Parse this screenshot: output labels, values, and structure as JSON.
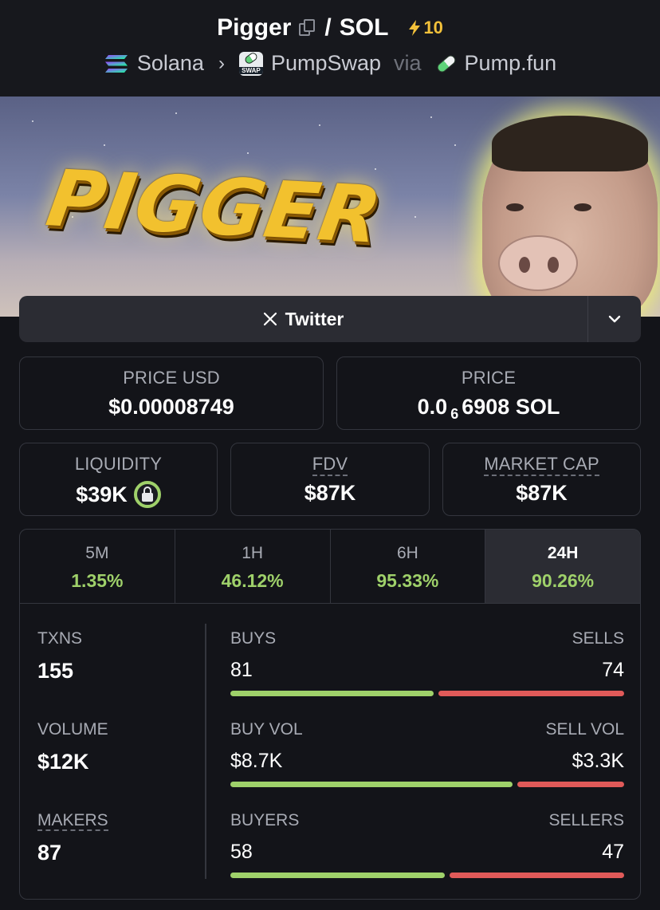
{
  "header": {
    "token_name": "Pigger",
    "separator": "/",
    "quote": "SOL",
    "boost_count": "10",
    "chain": "Solana",
    "dex": "PumpSwap",
    "via": "via",
    "launchpad": "Pump.fun",
    "swap_icon_text": "SWAP"
  },
  "banner": {
    "logo_text": "PIGGER"
  },
  "links": {
    "twitter_label": "Twitter"
  },
  "price_usd": {
    "label": "PRICE USD",
    "value": "$0.00008749"
  },
  "price_native": {
    "label": "PRICE",
    "prefix": "0.0",
    "zeros_sub": "6",
    "digits": "6908",
    "unit": "SOL"
  },
  "liquidity": {
    "label": "LIQUIDITY",
    "value": "$39K"
  },
  "fdv": {
    "label": "FDV",
    "value": "$87K"
  },
  "market_cap": {
    "label": "MARKET CAP",
    "value": "$87K"
  },
  "timeframes": [
    {
      "label": "5M",
      "change": "1.35%"
    },
    {
      "label": "1H",
      "change": "46.12%"
    },
    {
      "label": "6H",
      "change": "95.33%"
    },
    {
      "label": "24H",
      "change": "90.26%",
      "active": true
    }
  ],
  "stats": {
    "txns": {
      "label": "TXNS",
      "value": "155"
    },
    "volume": {
      "label": "VOLUME",
      "value": "$12K"
    },
    "makers": {
      "label": "MAKERS",
      "value": "87"
    },
    "buys": {
      "left_label": "BUYS",
      "right_label": "SELLS",
      "left_value": "81",
      "right_value": "74",
      "buy_fraction": 0.523
    },
    "vol": {
      "left_label": "BUY VOL",
      "right_label": "SELL VOL",
      "left_value": "$8.7K",
      "right_value": "$3.3K",
      "buy_fraction": 0.725
    },
    "buyers": {
      "left_label": "BUYERS",
      "right_label": "SELLERS",
      "left_value": "58",
      "right_value": "47",
      "buy_fraction": 0.552
    }
  },
  "colors": {
    "positive": "#9fd16a",
    "negative": "#e05a59",
    "boost": "#f3c13a",
    "background": "#131419"
  }
}
